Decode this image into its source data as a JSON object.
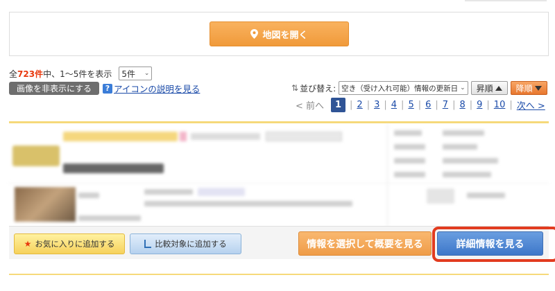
{
  "map": {
    "button_label": "地図を開く"
  },
  "results": {
    "prefix": "全",
    "total": "723件",
    "mid": "中、1〜5件を表示",
    "per_page_selected": "5件"
  },
  "image_toggle_label": "画像を非表示にする",
  "help": {
    "icon": "?",
    "label": "アイコンの説明を見る"
  },
  "sort": {
    "label": "並び替え:",
    "selected": "空き（受け入れ可能）情報の更新日",
    "asc_label": "昇順",
    "desc_label": "降順"
  },
  "pagination": {
    "prev_label": "< 前へ",
    "current": "1",
    "pages": [
      "2",
      "3",
      "4",
      "5",
      "6",
      "7",
      "8",
      "9",
      "10"
    ],
    "next_label": "次へ >"
  },
  "listing_actions": {
    "favorite_label": "お気に入りに追加する",
    "compare_label": "比較対象に追加する",
    "summary_label": "情報を選択して概要を見る",
    "detail_label": "詳細情報を見る"
  },
  "colors": {
    "accent_orange": "#f09a3a",
    "page_current": "#2f5496",
    "highlight_red": "#e23b1f",
    "detail_blue": "#3d77c9"
  }
}
